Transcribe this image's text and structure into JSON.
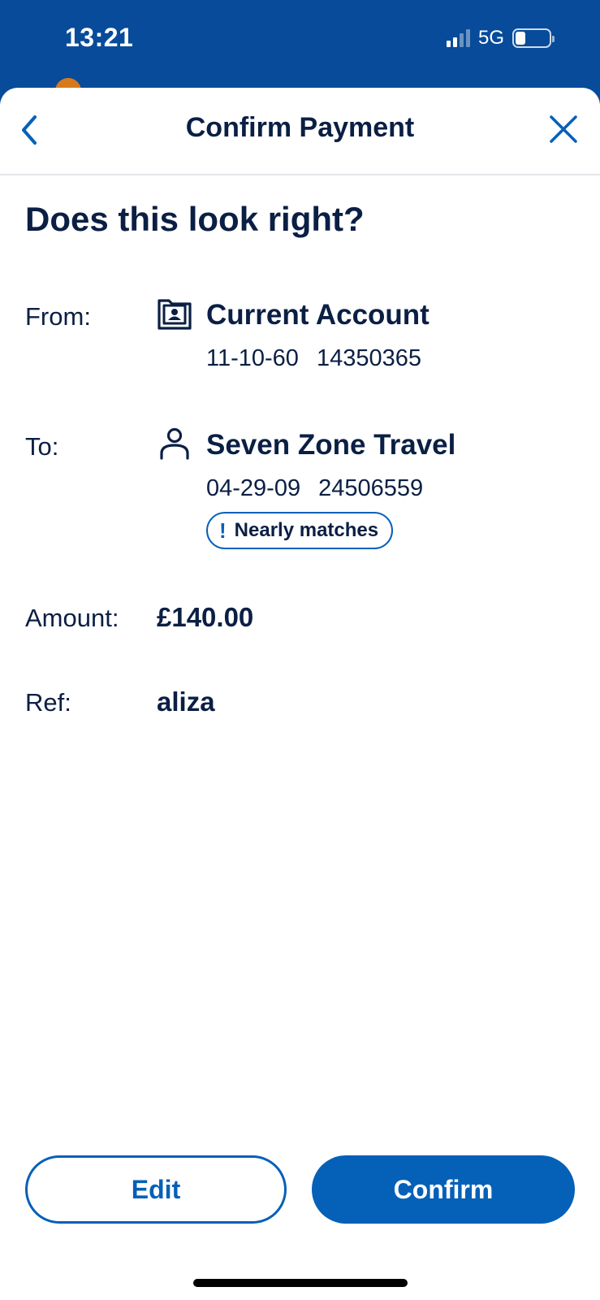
{
  "status_bar": {
    "time": "13:21",
    "network": "5G",
    "signal_bars": 2,
    "signal_max": 4,
    "battery_level": 0.3
  },
  "header": {
    "title": "Confirm Payment",
    "back_icon": "chevron-left-icon",
    "close_icon": "close-icon"
  },
  "question": "Does this look right?",
  "from": {
    "label": "From:",
    "icon": "account-folder-icon",
    "name": "Current Account",
    "sort_code": "11-10-60",
    "account_number": "14350365"
  },
  "to": {
    "label": "To:",
    "icon": "person-icon",
    "name": "Seven Zone Travel",
    "sort_code": "04-29-09",
    "account_number": "24506559",
    "badge": "Nearly matches",
    "badge_symbol": "!"
  },
  "amount": {
    "label": "Amount:",
    "value": "£140.00"
  },
  "reference": {
    "label": "Ref:",
    "value": "aliza"
  },
  "actions": {
    "edit": "Edit",
    "confirm": "Confirm"
  },
  "colors": {
    "brand_blue": "#0560b8",
    "header_blue": "#074b9a",
    "text_navy": "#0b1f44"
  }
}
